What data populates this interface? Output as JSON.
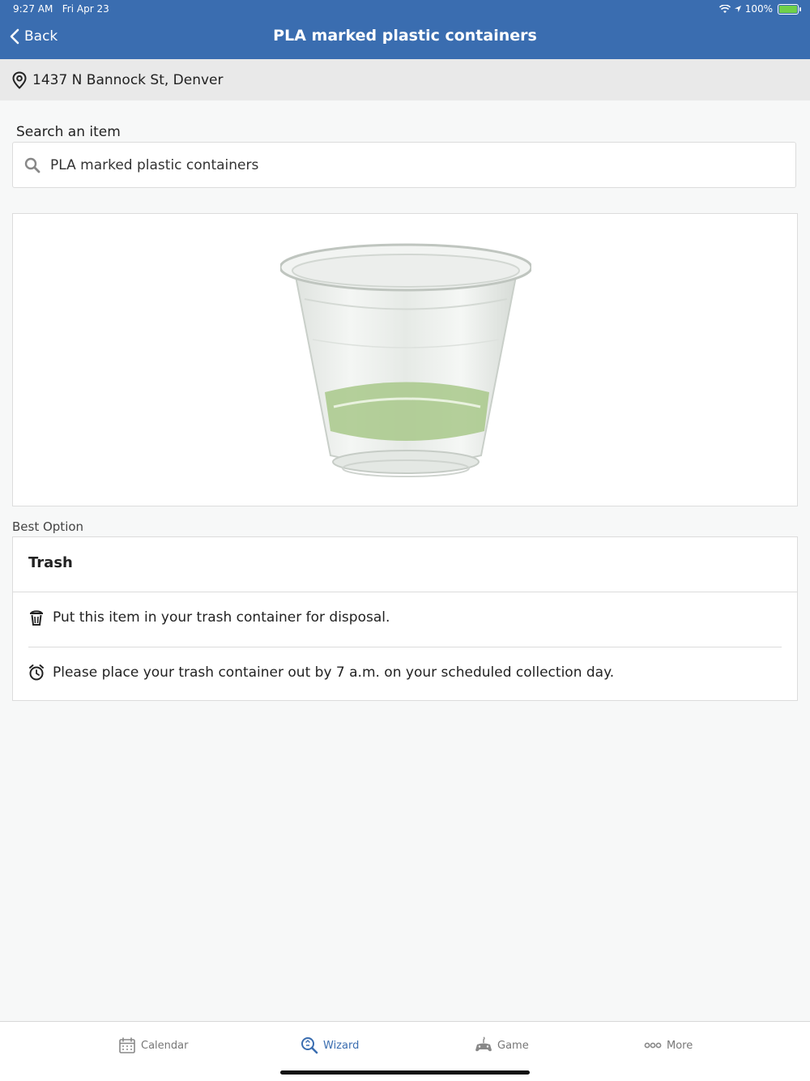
{
  "status_bar": {
    "time": "9:27 AM",
    "date": "Fri Apr 23",
    "battery": "100%"
  },
  "nav": {
    "back_label": "Back",
    "title": "PLA marked plastic containers"
  },
  "address": {
    "text": "1437 N Bannock St, Denver"
  },
  "search": {
    "label": "Search an item",
    "value": "PLA marked plastic containers"
  },
  "image": {
    "alt": "PLA marked plastic containers"
  },
  "best_option": {
    "section_label": "Best Option",
    "title": "Trash",
    "rows": [
      {
        "icon": "trash-can-icon",
        "text": "Put this item in your trash container for disposal."
      },
      {
        "icon": "alarm-clock-icon",
        "text": "Please place your trash container out by 7 a.m. on your scheduled collection day."
      }
    ]
  },
  "tabs": [
    {
      "label": "Calendar",
      "icon": "calendar-icon",
      "active": false
    },
    {
      "label": "Wizard",
      "icon": "wizard-search-icon",
      "active": true
    },
    {
      "label": "Game",
      "icon": "game-controller-icon",
      "active": false
    },
    {
      "label": "More",
      "icon": "more-dots-icon",
      "active": false
    }
  ],
  "colors": {
    "header": "#3a6db0",
    "active_tab": "#3a6db0",
    "inactive_tab": "#777777",
    "cup_band": "#9cbf7a"
  }
}
